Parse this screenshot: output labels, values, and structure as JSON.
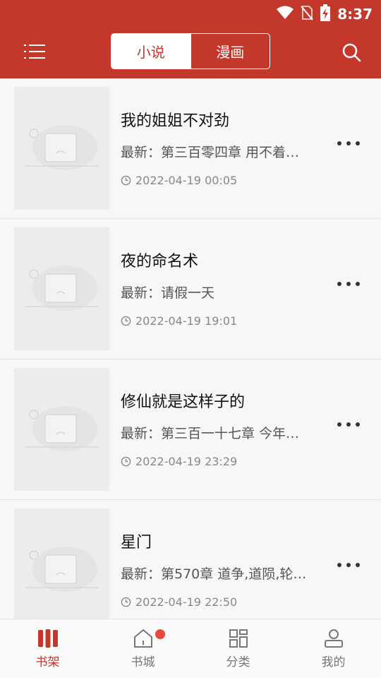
{
  "status_bar": {
    "time": "8:37"
  },
  "header": {
    "tabs": [
      {
        "label": "小说",
        "active": true
      },
      {
        "label": "漫画",
        "active": false
      }
    ]
  },
  "books": [
    {
      "title": "我的姐姐不对劲",
      "latest": "最新：第三百零四章 用不着…",
      "updated": "2022-04-19 00:05"
    },
    {
      "title": "夜的命名术",
      "latest": "最新：请假一天",
      "updated": "2022-04-19 19:01"
    },
    {
      "title": "修仙就是这样子的",
      "latest": "最新：第三百一十七章 今年…",
      "updated": "2022-04-19 23:29"
    },
    {
      "title": "星门",
      "latest": "最新：第570章 道争,道陨,轮…",
      "updated": "2022-04-19 22:50"
    }
  ],
  "bottom_nav": [
    {
      "label": "书架",
      "icon": "bookshelf-icon",
      "active": true
    },
    {
      "label": "书城",
      "icon": "home-icon",
      "active": false,
      "has_badge": true
    },
    {
      "label": "分类",
      "icon": "grid-icon",
      "active": false
    },
    {
      "label": "我的",
      "icon": "user-icon",
      "active": false
    }
  ],
  "colors": {
    "primary": "#c4372b",
    "badge": "#e74a3c"
  }
}
